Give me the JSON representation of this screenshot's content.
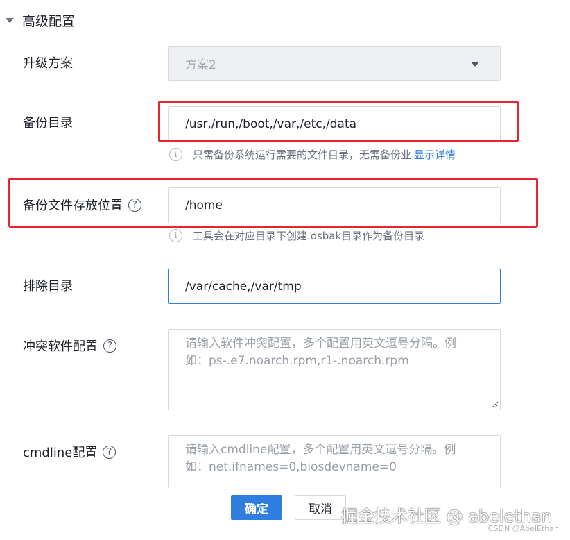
{
  "section": {
    "title": "高级配置",
    "caret_icon": "caret-down-icon"
  },
  "upgrade_plan": {
    "label": "升级方案",
    "value": "方案2"
  },
  "backup_dir": {
    "label": "备份目录",
    "value": "/usr,/run,/boot,/var,/etc,/data",
    "hint": "只需备份系统运行需要的文件目录，无需备份业",
    "hint_link": "显示详情"
  },
  "backup_location": {
    "label": "备份文件存放位置",
    "value": "/home",
    "hint": "工具会在对应目录下创建.osbak目录作为备份目录"
  },
  "exclude_dir": {
    "label": "排除目录",
    "value": "/var/cache,/var/tmp"
  },
  "conflict_config": {
    "label": "冲突软件配置",
    "placeholder": "请输入软件冲突配置，多个配置用英文逗号分隔。例如：ps-.e7.noarch.rpm,r1-.noarch.rpm"
  },
  "cmdline_config": {
    "label": "cmdline配置",
    "placeholder": "请输入cmdline配置，多个配置用英文逗号分隔。例如：net.ifnames=0,biosdevname=0"
  },
  "buttons": {
    "confirm": "确定",
    "cancel": "取消"
  },
  "icons": {
    "help": "?",
    "info": "i"
  },
  "colors": {
    "primary": "#2f7fe0",
    "highlight": "#e5262e"
  },
  "watermark": {
    "text": "掘金技术社区 @ abelethan",
    "sub": "CSDN @AbelEthan"
  }
}
